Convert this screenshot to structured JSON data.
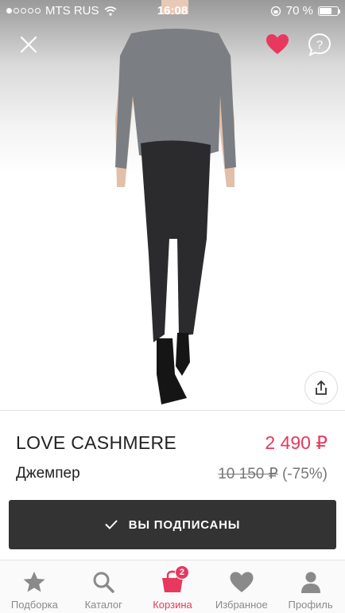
{
  "status_bar": {
    "carrier": "MTS RUS",
    "time": "16:08",
    "battery": "70 %",
    "battery_level": 0.7
  },
  "product": {
    "brand": "LOVE CASHMERE",
    "price": "2 490 ₽",
    "name": "Джемпер",
    "old_price": "10 150 ₽",
    "discount": "(-75%)"
  },
  "subscribe_button": {
    "label": "ВЫ ПОДПИСАНЫ"
  },
  "tab_bar": {
    "items": [
      {
        "label": "Подборка",
        "icon": "star-icon"
      },
      {
        "label": "Каталог",
        "icon": "search-icon"
      },
      {
        "label": "Корзина",
        "icon": "bag-icon",
        "badge": "2",
        "active": true
      },
      {
        "label": "Избранное",
        "icon": "heart-icon"
      },
      {
        "label": "Профиль",
        "icon": "user-icon"
      }
    ]
  },
  "colors": {
    "accent": "#e8385d",
    "button": "#333333",
    "inactive": "#8a8a8a"
  }
}
